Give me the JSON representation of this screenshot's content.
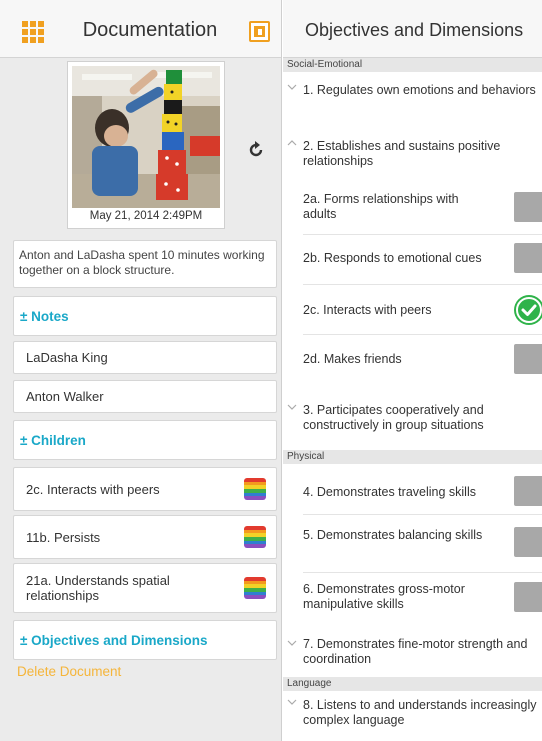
{
  "left_panel": {
    "title": "Documentation",
    "photo_date": "May 21, 2014 2:49PM",
    "caption": "Anton and LaDasha spent 10 minutes working together on a block structure.",
    "notes_label": "± Notes",
    "people": [
      "LaDasha King",
      "Anton Walker"
    ],
    "children_label": "± Children",
    "objectives": [
      {
        "label": "2c. Interacts with peers"
      },
      {
        "label": "11b. Persists"
      },
      {
        "label": "21a. Understands spatial relationships"
      }
    ],
    "objectives_label": "± Objectives and Dimensions",
    "delete_label": "Delete Document"
  },
  "right_panel": {
    "title": "Objectives and Dimensions",
    "categories": [
      "Social-Emotional",
      "Physical",
      "Language"
    ],
    "social": {
      "obj1": "1. Regulates own emotions and behaviors",
      "obj2": "2. Establishes and sustains positive relationships",
      "dims": [
        {
          "label": "2a. Forms relationships with adults",
          "checked": false
        },
        {
          "label": "2b. Responds to emotional cues",
          "checked": false
        },
        {
          "label": "2c. Interacts with peers",
          "checked": true
        },
        {
          "label": "2d. Makes friends",
          "checked": false
        }
      ],
      "obj3": "3. Participates cooperatively and constructively in group situations"
    },
    "physical": {
      "items": [
        "4. Demonstrates traveling skills",
        "5. Demonstrates balancing skills",
        "6. Demonstrates gross-motor manipulative skills"
      ],
      "obj7": "7. Demonstrates fine-motor strength and coordination"
    },
    "language": {
      "obj8": "8. Listens to and understands increasingly complex language"
    }
  },
  "colors": {
    "accent_orange": "#f0a020",
    "section_teal": "#1aa8c8",
    "delete_orange": "#f5b53a",
    "check_green": "#2fb34a",
    "unchecked_gray": "#a8a8a8"
  },
  "icons": {
    "menu": "grid-menu-icon",
    "share": "share-icon",
    "refresh": "rotate-icon",
    "rating": "rainbow-rating-icon",
    "check": "check-circle-icon",
    "chevron": "chevron-down-icon"
  }
}
